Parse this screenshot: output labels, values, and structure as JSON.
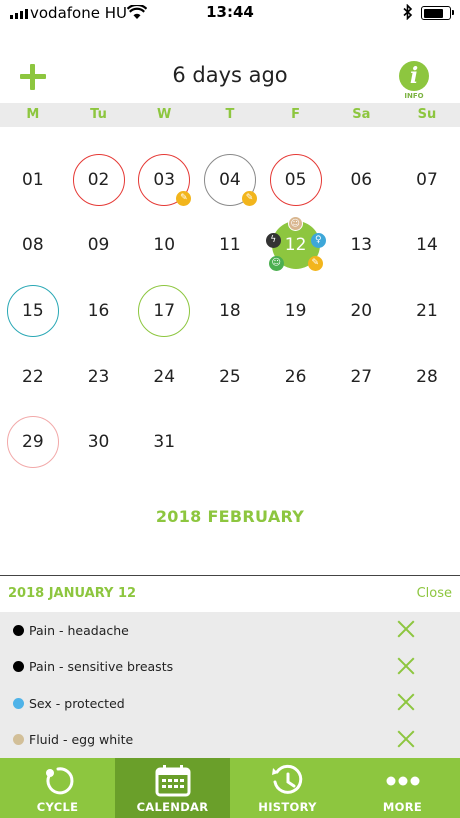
{
  "status_bar": {
    "carrier": "vodafone HU",
    "time": "13:44"
  },
  "header": {
    "title": "6 days ago",
    "info_label": "INFO",
    "info_glyph": "i"
  },
  "weekdays": [
    "M",
    "Tu",
    "W",
    "T",
    "F",
    "Sa",
    "Su"
  ],
  "calendar": {
    "month_label": "2018 FEBRUARY",
    "weeks": [
      [
        {
          "day": "01"
        },
        {
          "day": "02",
          "ring": "red"
        },
        {
          "day": "03",
          "ring": "red",
          "pencil": true
        },
        {
          "day": "04",
          "ring": "grey",
          "pencil": true
        },
        {
          "day": "05",
          "ring": "red"
        },
        {
          "day": "06"
        },
        {
          "day": "07"
        }
      ],
      [
        {
          "day": "08"
        },
        {
          "day": "09"
        },
        {
          "day": "10"
        },
        {
          "day": "11"
        },
        {
          "day": "12",
          "selected": true
        },
        {
          "day": "13"
        },
        {
          "day": "14"
        }
      ],
      [
        {
          "day": "15",
          "ring": "teal"
        },
        {
          "day": "16"
        },
        {
          "day": "17",
          "ring": "green"
        },
        {
          "day": "18"
        },
        {
          "day": "19"
        },
        {
          "day": "20"
        },
        {
          "day": "21"
        }
      ],
      [
        {
          "day": "22"
        },
        {
          "day": "23"
        },
        {
          "day": "24"
        },
        {
          "day": "25"
        },
        {
          "day": "26"
        },
        {
          "day": "27"
        },
        {
          "day": "28"
        }
      ],
      [
        {
          "day": "29",
          "ring": "pink"
        },
        {
          "day": "30"
        },
        {
          "day": "31"
        }
      ]
    ]
  },
  "detail": {
    "date": "2018 JANUARY 12",
    "close_label": "Close",
    "items": [
      {
        "label": "Pain - headache",
        "color": "#000000"
      },
      {
        "label": "Pain - sensitive breasts",
        "color": "#000000"
      },
      {
        "label": "Sex - protected",
        "color": "#4fb3e8"
      },
      {
        "label": "Fluid - egg white",
        "color": "#d2bf98"
      }
    ]
  },
  "tabs": [
    {
      "label": "CYCLE",
      "icon": "cycle-icon",
      "active": false
    },
    {
      "label": "CALENDAR",
      "icon": "calendar-icon",
      "active": true
    },
    {
      "label": "HISTORY",
      "icon": "history-icon",
      "active": false
    },
    {
      "label": "MORE",
      "icon": "more-icon",
      "active": false
    }
  ],
  "colors": {
    "accent": "#8dc63f",
    "accent_dark": "#6a9f2a",
    "period_ring": "#e53935",
    "note_badge": "#f2b51c"
  }
}
